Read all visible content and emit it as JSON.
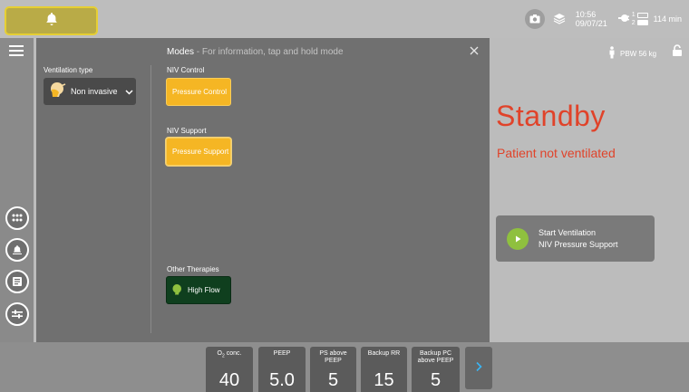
{
  "topbar": {
    "alarm_icon": "bell-icon",
    "time": "10:56",
    "date": "09/07/21",
    "battery_1": "1",
    "battery_2": "2",
    "remaining": "114 min"
  },
  "panel": {
    "title": "Modes",
    "subtitle": " - For information, tap and hold mode",
    "ventilation_type_label": "Ventilation type",
    "ventilation_type_value": "Non invasive",
    "groups": {
      "niv_control": {
        "label": "NIV Control",
        "button": "Pressure Control"
      },
      "niv_support": {
        "label": "NIV Support",
        "button": "Pressure Support"
      },
      "other": {
        "label": "Other Therapies",
        "button": "High Flow"
      }
    }
  },
  "status": {
    "pbw": "PBW 56 kg",
    "state": "Standby",
    "detail": "Patient not ventilated",
    "start_line1": "Start Ventilation",
    "start_line2": "NIV Pressure Support"
  },
  "params": [
    {
      "label": "O",
      "label_sub": "2",
      "label_tail": " conc.",
      "value": "40"
    },
    {
      "label": "PEEP",
      "value": "5.0"
    },
    {
      "label": "PS above PEEP",
      "value": "5"
    },
    {
      "label": "Backup RR",
      "value": "15"
    },
    {
      "label": "Backup PC above PEEP",
      "value": "5"
    }
  ],
  "colors": {
    "alarm_yellow": "#e6cf33",
    "mode_yellow": "#f5b624",
    "highflow_green": "#0f3f1e",
    "standby_red": "#e0432a",
    "play_green": "#8fc03f"
  }
}
